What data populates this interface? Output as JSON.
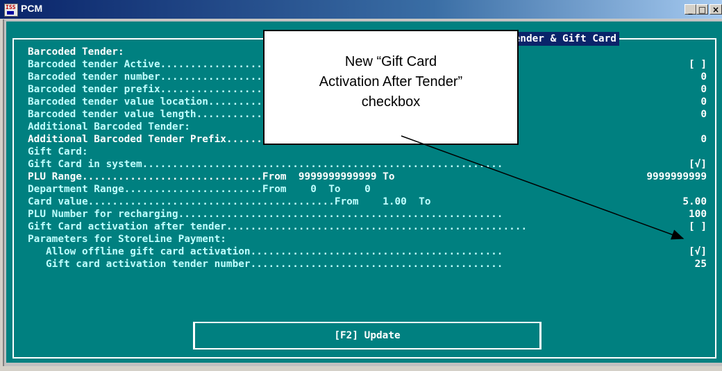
{
  "window": {
    "app_icon_text": "ISS",
    "title": "PCM",
    "minimize": "_",
    "maximize": "□",
    "close": "×"
  },
  "screen_title": "Barcoded Tender & Gift Card",
  "rows": [
    {
      "label": "Barcoded Tender:",
      "value": ""
    },
    {
      "label": "Barcoded tender Active.........................................................",
      "value": "[ ]"
    },
    {
      "label": "Barcoded tender number.........................................................",
      "value": "0"
    },
    {
      "label": "Barcoded tender prefix.........................................................",
      "value": "0"
    },
    {
      "label": "Barcoded tender value location.................................................",
      "value": "0"
    },
    {
      "label": "Barcoded tender value length...................................................",
      "value": "0"
    },
    {
      "label": "Additional Barcoded Tender:",
      "value": ""
    },
    {
      "label": "Additional Barcoded Tender Prefix..............................................",
      "value": "0"
    },
    {
      "label": "Gift Card:",
      "value": ""
    },
    {
      "label": "Gift Card in system............................................................",
      "value": "[√]"
    },
    {
      "label": "PLU Range..............................From  9999999999999 To",
      "value": "9999999999"
    },
    {
      "label": "Department Range.......................From    0  To    0",
      "value": ""
    },
    {
      "label": "Card value.........................................From    1.00  To",
      "value": "5.00"
    },
    {
      "label": "PLU Number for recharging......................................................",
      "value": "100"
    },
    {
      "label": "Gift Card activation after tender..................................................",
      "value": "[ ]"
    },
    {
      "label": "Parameters for StoreLine Payment:",
      "value": ""
    },
    {
      "label": "   Allow offline gift card activation..........................................",
      "value": "[√]"
    },
    {
      "label": "   Gift card activation tender number..........................................",
      "value": "25"
    }
  ],
  "update_button": "[F2] Update",
  "callout": {
    "line1": "New “Gift Card",
    "line2": "Activation After Tender”",
    "line3": "checkbox"
  },
  "colors": {
    "console_bg": "#008080",
    "text": "#c0ffff",
    "highlight_text": "#ffffff",
    "title_bar": "#0a246a"
  }
}
